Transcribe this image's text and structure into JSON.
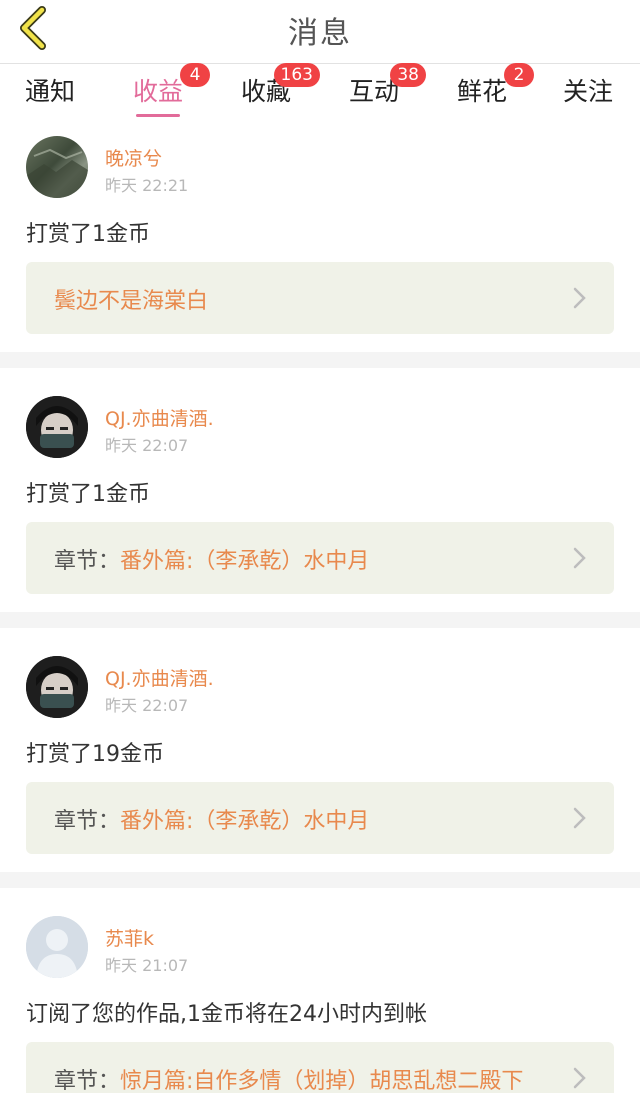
{
  "header": {
    "title": "消息"
  },
  "tabs": [
    {
      "label": "通知",
      "badge": ""
    },
    {
      "label": "收益",
      "badge": "4",
      "active": true
    },
    {
      "label": "收藏",
      "badge": "163"
    },
    {
      "label": "互动",
      "badge": "38"
    },
    {
      "label": "鲜花",
      "badge": "2"
    },
    {
      "label": "关注",
      "badge": ""
    }
  ],
  "messages": [
    {
      "user": "晚凉兮",
      "time": "昨天 22:21",
      "text": "打赏了1金币",
      "ref_label": "",
      "ref_title": "鬓边不是海棠白",
      "avatar": "landscape"
    },
    {
      "user": "QJ.亦曲清酒.",
      "time": "昨天 22:07",
      "text": "打赏了1金币",
      "ref_label": "章节：",
      "ref_title": "番外篇:（李承乾）水中月",
      "avatar": "masked-person"
    },
    {
      "user": "QJ.亦曲清酒.",
      "time": "昨天 22:07",
      "text": "打赏了19金币",
      "ref_label": "章节：",
      "ref_title": "番外篇:（李承乾）水中月",
      "avatar": "masked-person"
    },
    {
      "user": "苏菲k",
      "time": "昨天 21:07",
      "text": "订阅了您的作品,1金币将在24小时内到帐",
      "ref_label": "章节：",
      "ref_title": "惊月篇:自作多情（划掉）胡思乱想二殿下",
      "avatar": "default-person"
    }
  ],
  "colors": {
    "accent": "#e26b9a",
    "username": "#e8894d",
    "badge": "#f04244"
  }
}
